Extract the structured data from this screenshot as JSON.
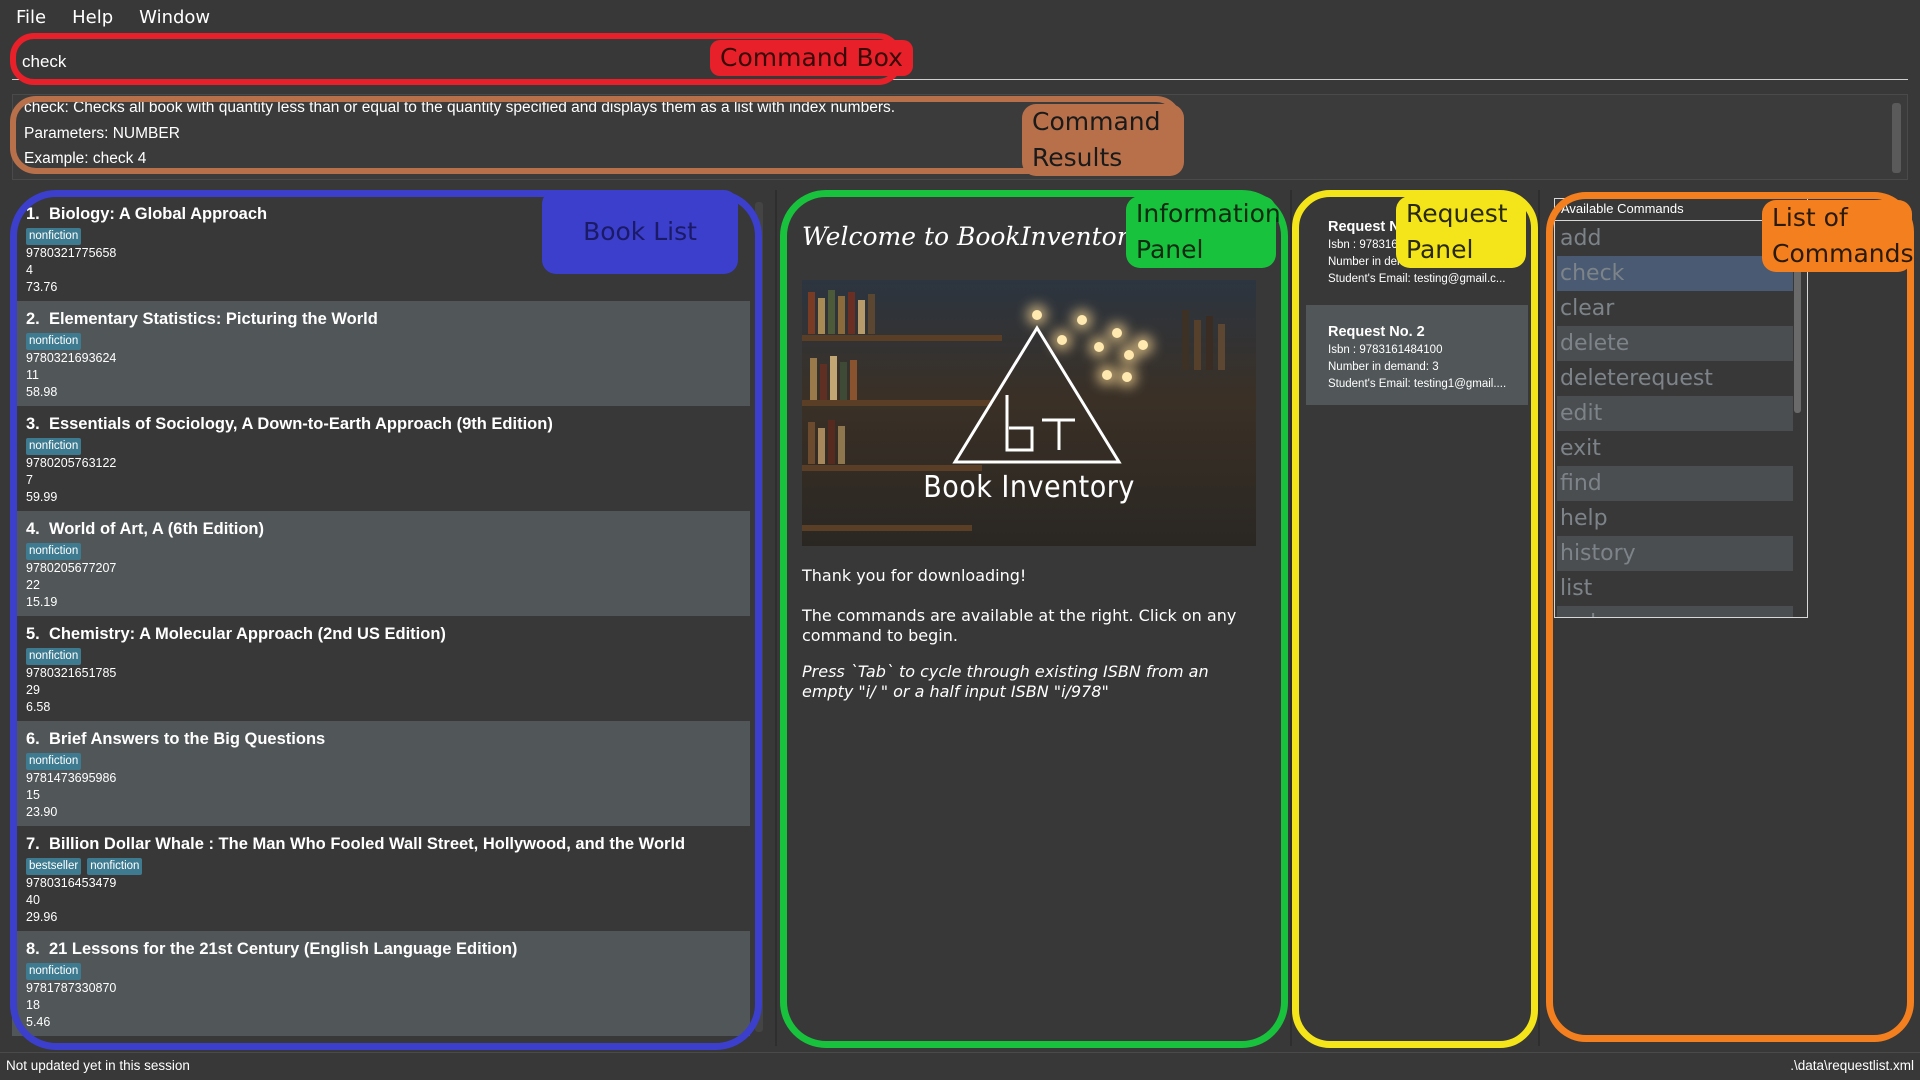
{
  "menu": [
    "File",
    "Help",
    "Window"
  ],
  "command_box": {
    "value": "check"
  },
  "result_display": {
    "lines": [
      "check: Checks all book with quantity less than or equal to the quantity specified and displays them as a list with index numbers.",
      "Parameters: NUMBER",
      "Example: check 4"
    ]
  },
  "books": [
    {
      "index": "1.",
      "title": "Biology: A Global Approach",
      "tags": [
        "nonfiction"
      ],
      "isbn": "9780321775658",
      "quantity": "4",
      "price": "73.76"
    },
    {
      "index": "2.",
      "title": "Elementary Statistics: Picturing the World",
      "tags": [
        "nonfiction"
      ],
      "isbn": "9780321693624",
      "quantity": "11",
      "price": "58.98"
    },
    {
      "index": "3.",
      "title": "Essentials of Sociology, A Down-to-Earth Approach (9th Edition)",
      "tags": [
        "nonfiction"
      ],
      "isbn": "9780205763122",
      "quantity": "7",
      "price": "59.99"
    },
    {
      "index": "4.",
      "title": "World of Art, A (6th Edition)",
      "tags": [
        "nonfiction"
      ],
      "isbn": "9780205677207",
      "quantity": "22",
      "price": "15.19"
    },
    {
      "index": "5.",
      "title": "Chemistry: A Molecular Approach (2nd US Edition)",
      "tags": [
        "nonfiction"
      ],
      "isbn": "9780321651785",
      "quantity": "29",
      "price": "6.58"
    },
    {
      "index": "6.",
      "title": "Brief Answers to the Big Questions",
      "tags": [
        "nonfiction"
      ],
      "isbn": "9781473695986",
      "quantity": "15",
      "price": "23.90"
    },
    {
      "index": "7.",
      "title": "Billion Dollar Whale : The Man Who Fooled Wall Street, Hollywood, and the World",
      "tags": [
        "bestseller",
        "nonfiction"
      ],
      "isbn": "9780316453479",
      "quantity": "40",
      "price": "29.96"
    },
    {
      "index": "8.",
      "title": "21 Lessons for the 21st Century (English Language Edition)",
      "tags": [
        "nonfiction"
      ],
      "isbn": "9781787330870",
      "quantity": "18",
      "price": "5.46"
    }
  ],
  "info_panel": {
    "welcome": "Welcome to BookInventory!",
    "banner_label": "Book Inventory",
    "thanks": "Thank you for downloading!",
    "commands_hint": "The commands are available at the right. Click on any command to begin.",
    "tab_hint": "Press `Tab` to cycle through existing ISBN from an empty \"i/ \" or a half input ISBN \"i/978\""
  },
  "requests": [
    {
      "title": "Request No. 1",
      "isbn": "Isbn : 9783161484100",
      "demand": "Number in demand: 3",
      "email": "Student's Email: testing@gmail.c..."
    },
    {
      "title": "Request No. 2",
      "isbn": "Isbn : 9783161484100",
      "demand": "Number in demand: 3",
      "email": "Student's Email: testing1@gmail...."
    }
  ],
  "commands_panel": {
    "header": "Available Commands",
    "items": [
      "add",
      "check",
      "clear",
      "delete",
      "deleterequest",
      "edit",
      "exit",
      "find",
      "help",
      "history",
      "list",
      "redo"
    ],
    "selected": "check"
  },
  "status": {
    "left": "Not updated yet in this session",
    "right": ".\\data\\requestlist.xml"
  },
  "annotations": [
    {
      "label": "Command Box",
      "color": "#e8202a",
      "text_color": "#e8202a"
    },
    {
      "label": "Command Results",
      "color": "#b7704a",
      "text_color": "#1a1a1a"
    },
    {
      "label": "Book List",
      "color": "#3b3fcc",
      "text_color": "#1a1a66"
    },
    {
      "label": "Information Panel",
      "color": "#19c23c",
      "text_color": "#0d2a12"
    },
    {
      "label": "Request Panel",
      "color": "#f3e51a",
      "text_color": "#2a2a0a"
    },
    {
      "label": "List of Commands",
      "color": "#f37f1f",
      "text_color": "#2a1a0a"
    }
  ]
}
